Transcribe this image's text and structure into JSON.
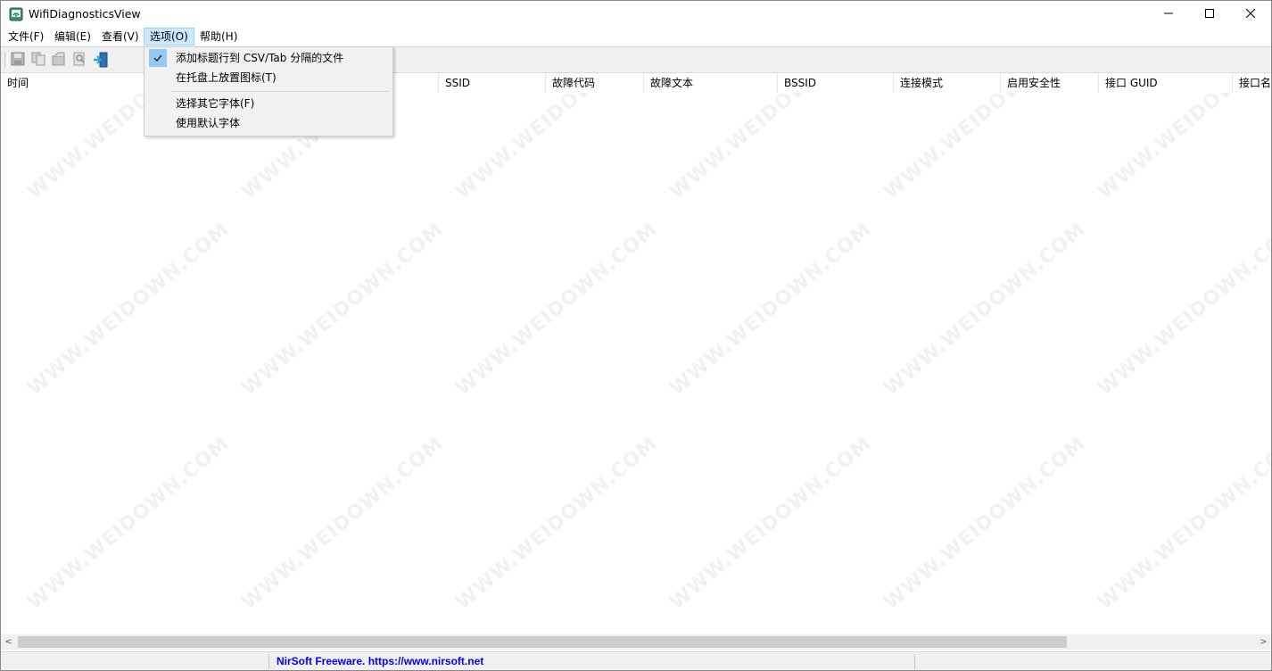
{
  "window": {
    "title": "WifiDiagnosticsView",
    "min_glyph": "—",
    "close_glyph": "✕"
  },
  "menu": [
    {
      "label": "文件(F)"
    },
    {
      "label": "编辑(E)"
    },
    {
      "label": "查看(V)"
    },
    {
      "label": "选项(O)"
    },
    {
      "label": "帮助(H)"
    }
  ],
  "toolbar": {
    "icons": [
      "save-icon",
      "copy-icon",
      "properties-icon",
      "find-icon",
      "exit-icon"
    ]
  },
  "columns": [
    {
      "label": "时间"
    },
    {
      "label": "SSID"
    },
    {
      "label": "故障代码"
    },
    {
      "label": "故障文本"
    },
    {
      "label": "BSSID"
    },
    {
      "label": "连接模式"
    },
    {
      "label": "启用安全性"
    },
    {
      "label": "接口 GUID"
    },
    {
      "label": "接口名"
    }
  ],
  "options_menu": {
    "items": [
      {
        "label": "添加标题行到 CSV/Tab 分隔的文件",
        "checked": true
      },
      {
        "label": "在托盘上放置图标(T)",
        "checked": false
      },
      {
        "label": "选择其它字体(F)",
        "checked": false
      },
      {
        "label": "使用默认字体",
        "checked": false
      }
    ]
  },
  "scrollbar": {
    "left_arrow": "<",
    "right_arrow": ">"
  },
  "status": {
    "link_text": "NirSoft Freeware. https://www.nirsoft.net"
  },
  "watermark": "WWW.WEIDOWN.COM",
  "colors": {
    "menu_highlight": "#cce8ff",
    "check_highlight": "#91c9f7",
    "link": "#0000ff"
  }
}
